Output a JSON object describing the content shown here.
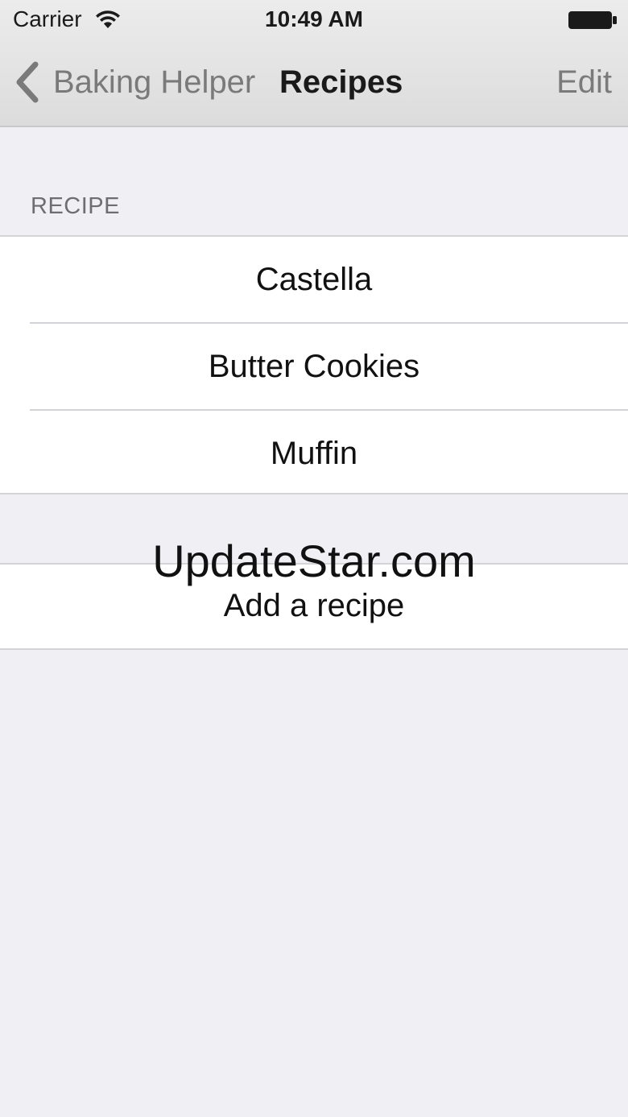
{
  "status_bar": {
    "carrier": "Carrier",
    "time": "10:49 AM",
    "wifi_icon": "wifi-icon",
    "battery_icon": "battery-icon"
  },
  "nav_bar": {
    "back_label": "Baking Helper",
    "back_icon": "chevron-left-icon",
    "title": "Recipes",
    "edit_label": "Edit"
  },
  "recipe_section": {
    "header": "RECIPE",
    "items": [
      "Castella",
      "Butter Cookies",
      "Muffin"
    ]
  },
  "add_section": {
    "label": "Add a recipe"
  },
  "watermark": "UpdateStar.com",
  "colors": {
    "background": "#efeff4",
    "nav_gray": "#7a7a7a",
    "cell_bg": "#ffffff",
    "separator": "#d4d4d8"
  }
}
